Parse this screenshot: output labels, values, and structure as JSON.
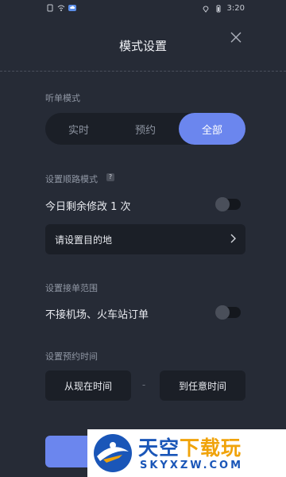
{
  "statusbar": {
    "time": "3:20"
  },
  "header": {
    "title": "模式设置"
  },
  "order_mode": {
    "label": "听单模式",
    "options": [
      "实时",
      "预约",
      "全部"
    ],
    "selected": "全部"
  },
  "route_mode": {
    "label": "设置顺路模式",
    "help": "?",
    "remaining_text": "今日剩余修改 1 次",
    "toggle_on": false,
    "destination_placeholder": "请设置目的地"
  },
  "range": {
    "label": "设置接单范围",
    "exclude_text": "不接机场、火车站订单",
    "toggle_on": false
  },
  "booking_time": {
    "label": "设置预约时间",
    "from_label": "从现在时间",
    "separator": "-",
    "to_label": "到任意时间"
  },
  "watermark": {
    "brand_main": "天空",
    "brand_accent": "下载玩",
    "brand_url": "SKYXZW.COM"
  }
}
